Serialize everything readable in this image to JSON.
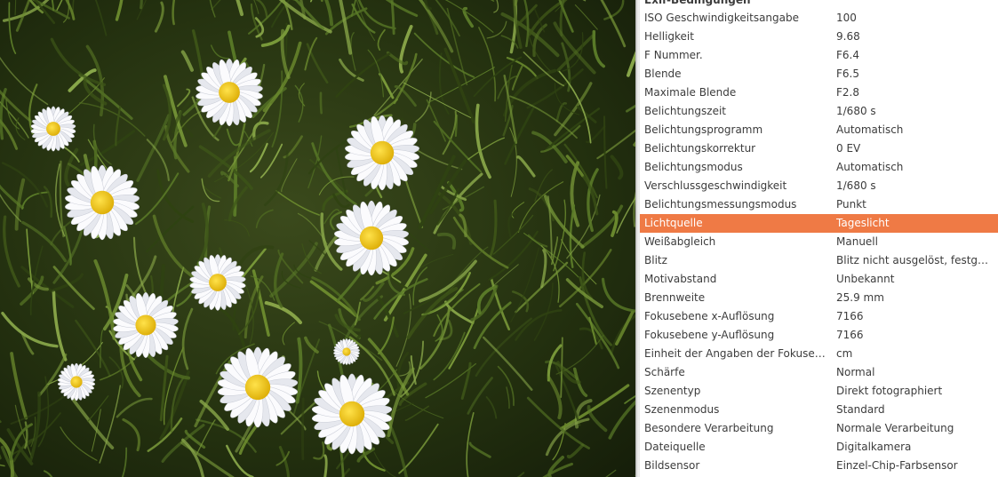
{
  "photo": {
    "subject": "daisies-in-grass"
  },
  "exif": {
    "section_title": "Exif-Bedingungen",
    "selected_row": 11,
    "selection_color": "#ef7a45",
    "rows": [
      {
        "key": "ISO Geschwindigkeitsangabe",
        "value": "100"
      },
      {
        "key": "Helligkeit",
        "value": "9.68"
      },
      {
        "key": "F Nummer.",
        "value": "F6.4"
      },
      {
        "key": "Blende",
        "value": "F6.5"
      },
      {
        "key": "Maximale Blende",
        "value": "F2.8"
      },
      {
        "key": "Belichtungszeit",
        "value": "1/680 s"
      },
      {
        "key": "Belichtungsprogramm",
        "value": "Automatisch"
      },
      {
        "key": "Belichtungskorrektur",
        "value": "0 EV"
      },
      {
        "key": "Belichtungsmodus",
        "value": "Automatisch"
      },
      {
        "key": "Verschlussgeschwindigkeit",
        "value": "1/680 s"
      },
      {
        "key": "Belichtungsmessungsmodus",
        "value": "Punkt"
      },
      {
        "key": "Lichtquelle",
        "value": "Tageslicht"
      },
      {
        "key": "Weißabgleich",
        "value": "Manuell"
      },
      {
        "key": "Blitz",
        "value": "Blitz nicht ausgelöst, festgel…"
      },
      {
        "key": "Motivabstand",
        "value": "Unbekannt"
      },
      {
        "key": "Brennweite",
        "value": "25.9 mm"
      },
      {
        "key": "Fokusebene x-Auflösung",
        "value": "7166"
      },
      {
        "key": "Fokusebene y-Auflösung",
        "value": "7166"
      },
      {
        "key": "Einheit der Angaben der Fokusebene",
        "value": "cm"
      },
      {
        "key": "Schärfe",
        "value": "Normal"
      },
      {
        "key": "Szenentyp",
        "value": "Direkt fotographiert"
      },
      {
        "key": "Szenenmodus",
        "value": "Standard"
      },
      {
        "key": "Besondere Verarbeitung",
        "value": "Normale Verarbeitung"
      },
      {
        "key": "Dateiquelle",
        "value": "Digitalkamera"
      },
      {
        "key": "Bildsensor",
        "value": "Einzel-Chip-Farbsensor"
      }
    ]
  }
}
